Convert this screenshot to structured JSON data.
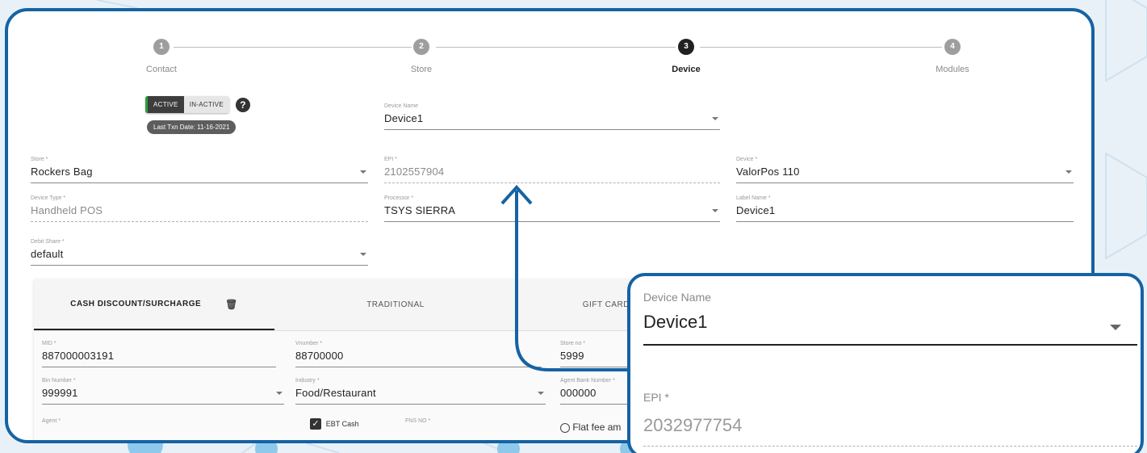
{
  "stepper": {
    "steps": [
      {
        "num": "1",
        "label": "Contact"
      },
      {
        "num": "2",
        "label": "Store"
      },
      {
        "num": "3",
        "label": "Device"
      },
      {
        "num": "4",
        "label": "Modules"
      }
    ],
    "active_step": 3
  },
  "status": {
    "active_label": "ACTIVE",
    "inactive_label": "IN-ACTIVE",
    "help_symbol": "?",
    "last_txn": "Last Txn Date: 11-16-2021"
  },
  "form": {
    "device_name": {
      "label": "Device Name",
      "value": "Device1"
    },
    "store": {
      "label": "Store *",
      "value": "Rockers Bag"
    },
    "epi": {
      "label": "EPI *",
      "value": "2102557904"
    },
    "device": {
      "label": "Device *",
      "value": "ValorPos 110"
    },
    "device_type": {
      "label": "Device Type *",
      "value": "Handheld POS"
    },
    "processor": {
      "label": "Processor *",
      "value": "TSYS SIERRA"
    },
    "label_name": {
      "label": "Label Name *",
      "value": "Device1"
    },
    "debit_share": {
      "label": "Debit Share *",
      "value": "default"
    }
  },
  "tabs": {
    "items": [
      "CASH DISCOUNT/SURCHARGE",
      "TRADITIONAL",
      "GIFT CARD"
    ],
    "active_icon": "filter-delete-icon"
  },
  "processor_fields": {
    "mid": {
      "label": "MID *",
      "value": "887000003191"
    },
    "vnumber": {
      "label": "Vnumber *",
      "value": "88700000"
    },
    "store_no": {
      "label": "Store no *",
      "value": "5999"
    },
    "bin": {
      "label": "Bin Number *",
      "value": "999991"
    },
    "industry": {
      "label": "Industry *",
      "value": "Food/Restaurant"
    },
    "agent_bank": {
      "label": "Agent Bank Number *",
      "value": "000000"
    },
    "agent": {
      "label": "Agent *"
    },
    "ebt_cash": {
      "label": "EBT Cash",
      "checked": true
    },
    "fns_no": {
      "label": "FNS NO *"
    },
    "flat_fee": {
      "label": "Flat fee am"
    }
  },
  "zoom": {
    "device_name_label": "Device Name",
    "device_name_value": "Device1",
    "epi_label": "EPI *",
    "epi_value": "2032977754"
  },
  "colors": {
    "accent": "#1563a3",
    "active_green": "#2e9f3e"
  }
}
